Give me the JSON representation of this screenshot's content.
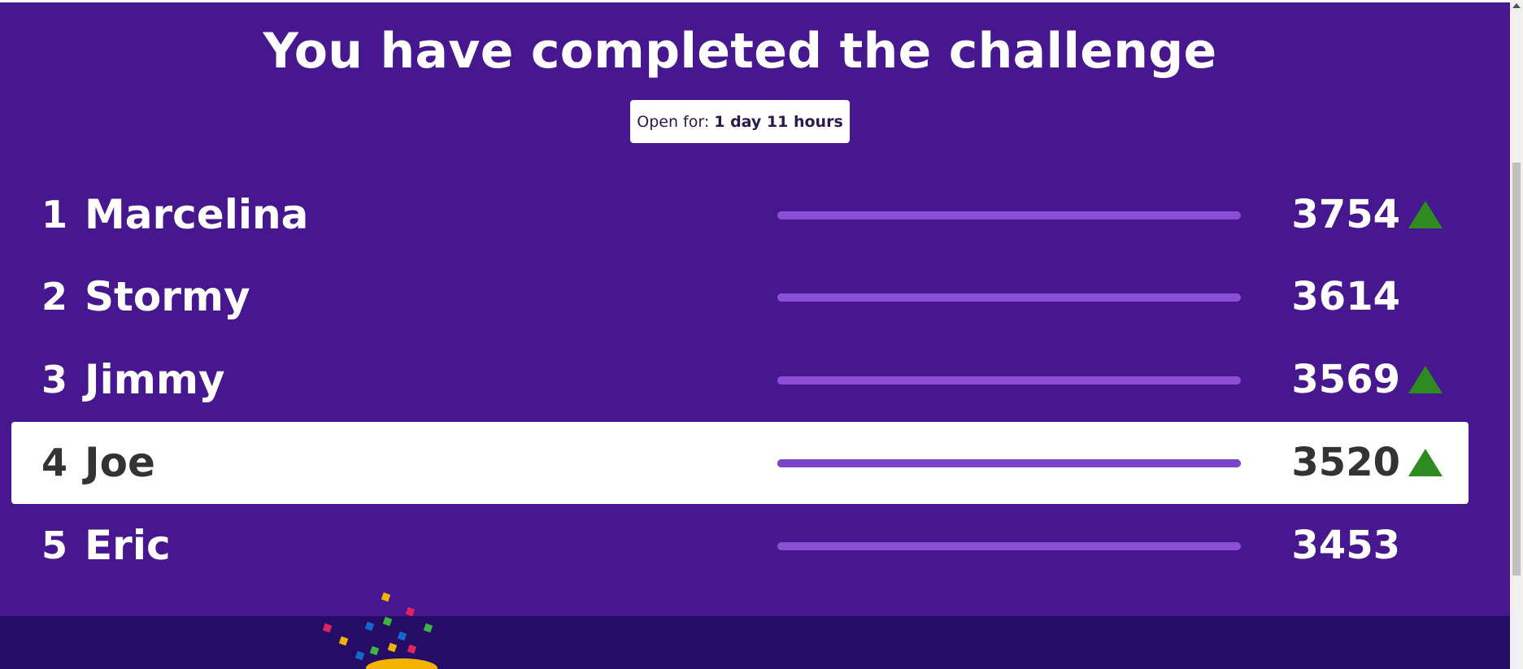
{
  "header": {
    "title": "You have completed the challenge",
    "open_for_label": "Open for:",
    "open_for_value": "1 day 11 hours"
  },
  "leaderboard": [
    {
      "rank": "1",
      "name": "Marcelina",
      "score": "3754",
      "progress": 1.0,
      "trend": "up",
      "highlight": false
    },
    {
      "rank": "2",
      "name": "Stormy",
      "score": "3614",
      "progress": 1.0,
      "trend": "none",
      "highlight": false
    },
    {
      "rank": "3",
      "name": "Jimmy",
      "score": "3569",
      "progress": 1.0,
      "trend": "up",
      "highlight": false
    },
    {
      "rank": "4",
      "name": "Joe",
      "score": "3520",
      "progress": 1.0,
      "trend": "up",
      "highlight": true
    },
    {
      "rank": "5",
      "name": "Eric",
      "score": "3453",
      "progress": 1.0,
      "trend": "none",
      "highlight": false
    }
  ],
  "icons": {
    "trend_up": "triangle-up-icon",
    "decoration": "confetti-icon"
  },
  "colors": {
    "background": "#46178f",
    "footer_band": "#250c66",
    "highlight_row": "#ffffff",
    "progress_bar": "#8a4fd4",
    "trend_up": "#2e8b1f"
  }
}
